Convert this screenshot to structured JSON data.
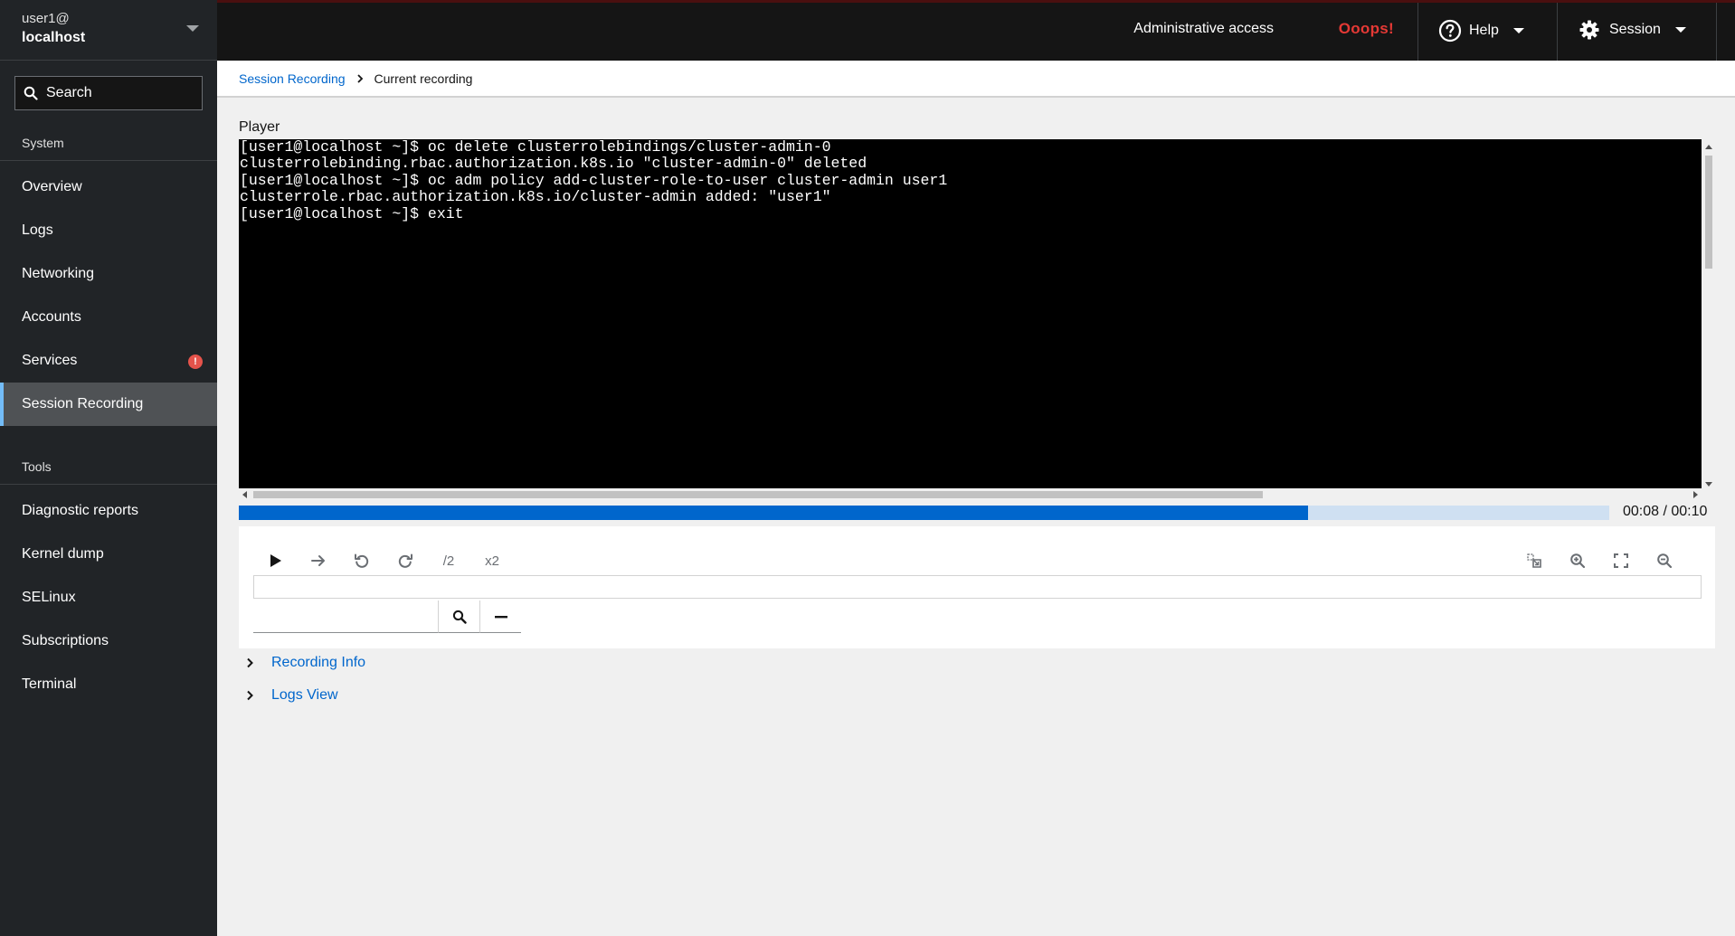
{
  "host": {
    "user": "user1@",
    "name": "localhost"
  },
  "search": {
    "label": "Search"
  },
  "nav": {
    "system_header": "System",
    "system_items": [
      {
        "label": "Overview"
      },
      {
        "label": "Logs"
      },
      {
        "label": "Networking"
      },
      {
        "label": "Accounts"
      },
      {
        "label": "Services",
        "badge": "!"
      },
      {
        "label": "Session Recording"
      }
    ],
    "tools_header": "Tools",
    "tools_items": [
      {
        "label": "Diagnostic reports"
      },
      {
        "label": "Kernel dump"
      },
      {
        "label": "SELinux"
      },
      {
        "label": "Subscriptions"
      },
      {
        "label": "Terminal"
      }
    ]
  },
  "topbar": {
    "admin_access": "Administrative access",
    "ooops": "Ooops!",
    "help": "Help",
    "session": "Session"
  },
  "breadcrumb": {
    "parent": "Session Recording",
    "current": "Current recording"
  },
  "player": {
    "label": "Player",
    "terminal_lines": [
      "[user1@localhost ~]$ oc delete clusterrolebindings/cluster-admin-0",
      "clusterrolebinding.rbac.authorization.k8s.io \"cluster-admin-0\" deleted",
      "[user1@localhost ~]$ oc adm policy add-cluster-role-to-user cluster-admin user1",
      "clusterrole.rbac.authorization.k8s.io/cluster-admin added: \"user1\"",
      "[user1@localhost ~]$ exit"
    ],
    "progress_fraction": 0.78,
    "time": "00:08 / 00:10",
    "speed_down": "/2",
    "speed_up": "x2"
  },
  "expanders": {
    "recording_info": "Recording Info",
    "logs_view": "Logs View"
  }
}
